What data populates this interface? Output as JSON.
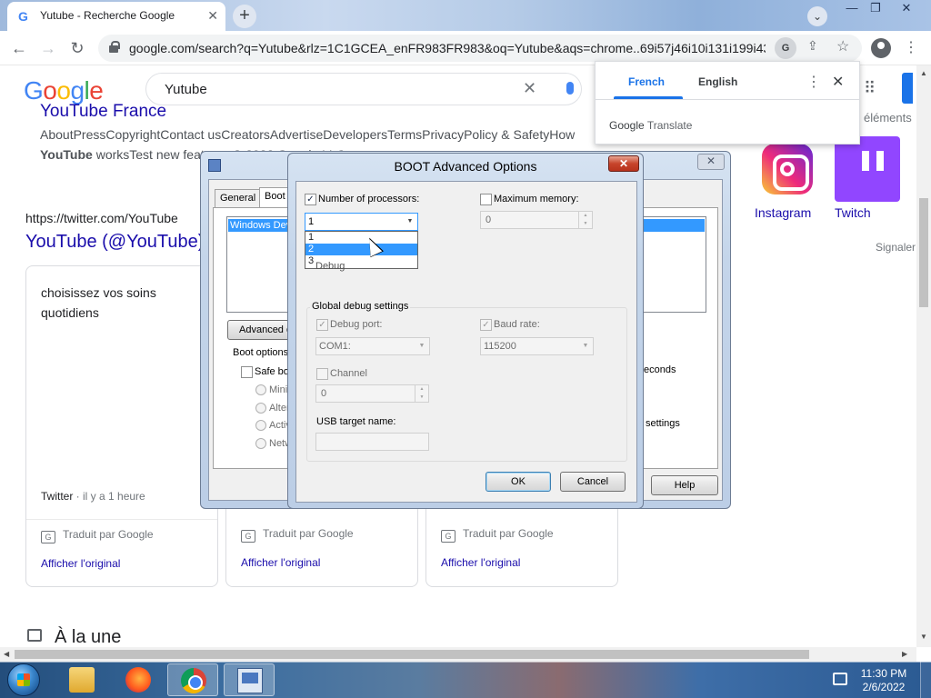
{
  "browser": {
    "tab_title": "Yutube - Recherche Google",
    "tab_favicon": "G",
    "url": "google.com/search?q=Yutube&rlz=1C1GCEA_enFR983FR983&oq=Yutube&aqs=chrome..69i57j46i10i131i199i43...",
    "translate_popup": {
      "tab_french": "French",
      "tab_english": "English",
      "brand_google": "Google",
      "brand_translate": "Translate"
    }
  },
  "google": {
    "search_query": "Yutube",
    "logo": [
      "G",
      "o",
      "o",
      "g",
      "l",
      "e"
    ],
    "logo_colors": [
      "#4285f4",
      "#ea4335",
      "#fbbc05",
      "#4285f4",
      "#34a853",
      "#ea4335"
    ],
    "yt_france_title": "YouTube France",
    "links_row": "AboutPressCopyrightContact usCreatorsAdvertiseDevelopersTermsPrivacyPolicy & SafetyHow",
    "yt_works_bold": "YouTube",
    "yt_works_rest": " worksTest new features © 2022 Google LLC",
    "twitter_url": "https://twitter.com/YouTube",
    "twitter_title": "YouTube (@YouTube) · Twitter",
    "card1_text": "choisissez vos soins quotidiens",
    "card1_source": "Twitter",
    "card1_time": " · il y a 1 heure",
    "translated_by": "Traduit par Google",
    "show_original": "Afficher l'original",
    "social_instagram": "Instagram",
    "social_twitch": "Twitch",
    "elements_text": "éléments",
    "signaler": "Signaler",
    "a_la_une": "À la une"
  },
  "msconfig": {
    "tab_general": "General",
    "tab_boot": "Boot",
    "boot_entry": "Windows Dev",
    "advanced_button": "Advanced o",
    "boot_options_label": "Boot options",
    "safe_boot": "Safe bo",
    "radio_minimal": "Minim",
    "radio_alternate": "Alter",
    "radio_active": "Activ",
    "radio_network": "Netw",
    "seconds_text": "econds",
    "settings_text": "settings",
    "help_button": "Help"
  },
  "boot_dialog": {
    "title": "BOOT Advanced Options",
    "num_processors_label": "Number of processors:",
    "num_processors_checked": true,
    "num_processors_value": "1",
    "processor_options": [
      "1",
      "2",
      "3"
    ],
    "processor_highlighted": "2",
    "max_memory_label": "Maximum memory:",
    "max_memory_checked": false,
    "max_memory_value": "0",
    "debug_text": "Debug",
    "global_debug_label": "Global debug settings",
    "debug_port_label": "Debug port:",
    "debug_port_value": "COM1:",
    "baud_rate_label": "Baud rate:",
    "baud_rate_value": "115200",
    "channel_label": "Channel",
    "channel_value": "0",
    "usb_target_label": "USB target name:",
    "ok_button": "OK",
    "cancel_button": "Cancel"
  },
  "taskbar": {
    "clock_time": "11:30 PM",
    "clock_date": "2/6/2022"
  }
}
